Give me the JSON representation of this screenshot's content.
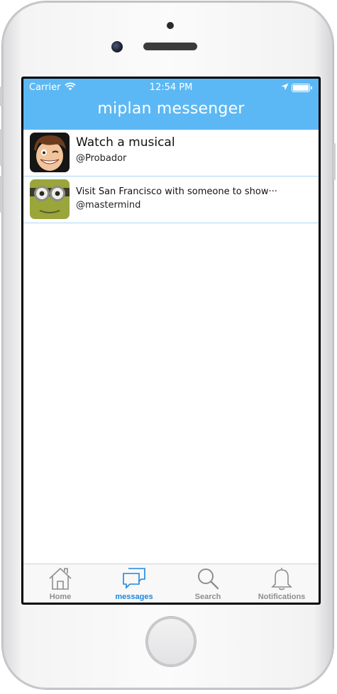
{
  "status_bar": {
    "carrier": "Carrier",
    "time": "12:54 PM"
  },
  "header": {
    "title": "miplan messenger"
  },
  "messages": [
    {
      "title": "Watch a musical",
      "user": "@Probador",
      "avatar": "cartoon-man-avatar"
    },
    {
      "title": "Visit San Francisco with someone to show···",
      "user": "@mastermind",
      "avatar": "minion-avatar"
    }
  ],
  "tabs": [
    {
      "label": "Home",
      "icon": "home-icon"
    },
    {
      "label": "messages",
      "icon": "chat-bubbles-icon",
      "active": true
    },
    {
      "label": "Search",
      "icon": "magnifier-icon"
    },
    {
      "label": "Notifications",
      "icon": "bell-icon"
    }
  ],
  "colors": {
    "header_bg": "#5cb8f4",
    "active_tab": "#1a87e0",
    "inactive_tab": "#8e8e8e",
    "row_divider": "#a9d8f2"
  }
}
